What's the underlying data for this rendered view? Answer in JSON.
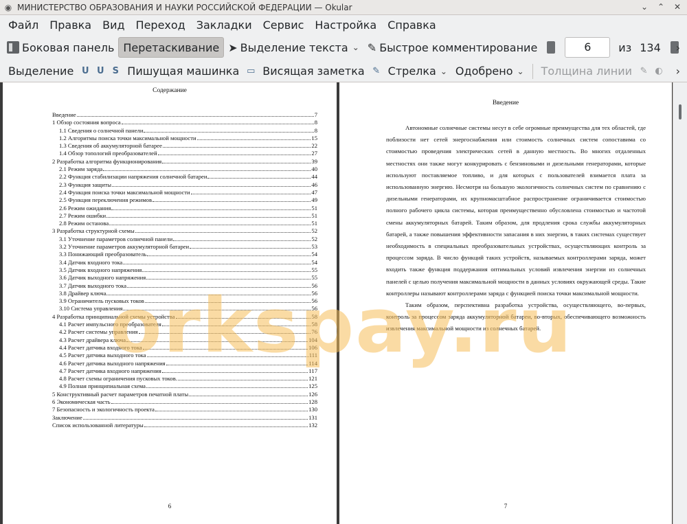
{
  "window": {
    "title": "МИНИСТЕРСТВО ОБРАЗОВАНИЯ И НАУКИ РОССИЙСКОЙ ФЕДЕРАЦИИ  — Okular"
  },
  "menu": [
    "Файл",
    "Правка",
    "Вид",
    "Переход",
    "Закладки",
    "Сервис",
    "Настройка",
    "Справка"
  ],
  "toolbar1": {
    "sidebar": "Боковая панель",
    "browse": "Перетаскивание",
    "text_select": "Выделение текста",
    "quick_comment": "Быстрое комментирование",
    "page_current": "6",
    "page_of": "из",
    "page_total": "134"
  },
  "toolbar2": {
    "highlight": "Выделение",
    "typewriter": "Пишущая машинка",
    "hanging_note": "Висящая заметка",
    "arrow": "Стрелка",
    "approved": "Одобрено",
    "line_width": "Толщина линии"
  },
  "left_page": {
    "title": "Содержание",
    "page_number": "6",
    "toc": [
      {
        "label": "Введение",
        "page": "7",
        "level": 1
      },
      {
        "label": "1 Обзор состояния вопроса",
        "page": "8",
        "level": 1
      },
      {
        "label": "1.1 Сведения о солнечной панели",
        "page": "8",
        "level": 2
      },
      {
        "label": "1.2 Алгоритмы поиска точки максимальной мощности",
        "page": "15",
        "level": 2
      },
      {
        "label": "1.3 Сведения об аккумуляторной батарее",
        "page": "22",
        "level": 2
      },
      {
        "label": "1.4 Обзор топологий преобразователей",
        "page": "27",
        "level": 2
      },
      {
        "label": "2 Разработка алгоритма функционирования",
        "page": "39",
        "level": 1
      },
      {
        "label": "2.1 Режим заряда",
        "page": "40",
        "level": 2
      },
      {
        "label": "2.2 Функция стабилизации напряжения солнечной батареи",
        "page": "44",
        "level": 2
      },
      {
        "label": "2.3 Функция защиты",
        "page": "46",
        "level": 2
      },
      {
        "label": "2.4 Функция поиска точки максимальной мощности",
        "page": "47",
        "level": 2
      },
      {
        "label": "2.5 Функция переключения режимов",
        "page": "49",
        "level": 2
      },
      {
        "label": "2.6 Режим ожидания",
        "page": "51",
        "level": 2
      },
      {
        "label": "2.7 Режим ошибки",
        "page": "51",
        "level": 2
      },
      {
        "label": "2.8 Режим останова",
        "page": "51",
        "level": 2
      },
      {
        "label": "3 Разработка структурной схемы",
        "page": "52",
        "level": 1
      },
      {
        "label": "3.1 Уточнение параметров солнечной панели",
        "page": "52",
        "level": 2
      },
      {
        "label": "3.2 Уточнение параметров аккумуляторной батареи",
        "page": "53",
        "level": 2
      },
      {
        "label": "3.3 Понижающий преобразователь",
        "page": "54",
        "level": 2
      },
      {
        "label": "3.4 Датчик входного тока",
        "page": "54",
        "level": 2
      },
      {
        "label": "3.5 Датчик входного напряжения",
        "page": "55",
        "level": 2
      },
      {
        "label": "3.6 Датчик выходного напряжения",
        "page": "55",
        "level": 2
      },
      {
        "label": "3.7 Датчик выходного тока",
        "page": "56",
        "level": 2
      },
      {
        "label": "3.8 Драйвер ключа",
        "page": "56",
        "level": 2
      },
      {
        "label": "3.9 Ограничитель пусковых токов",
        "page": "56",
        "level": 2
      },
      {
        "label": "3.10 Система управления",
        "page": "56",
        "level": 2
      },
      {
        "label": "4 Разработка принципиальной схемы устройства",
        "page": "58",
        "level": 1
      },
      {
        "label": "4.1 Расчет импульсного преобразователя",
        "page": "58",
        "level": 2
      },
      {
        "label": "4.2 Расчет системы управления",
        "page": "76",
        "level": 2
      },
      {
        "label": "4.3 Расчет драйвера ключа",
        "page": "104",
        "level": 2
      },
      {
        "label": "4.4  Расчет датчика входного тока",
        "page": "106",
        "level": 2
      },
      {
        "label": "4.5 Расчет датчика выходного тока",
        "page": "111",
        "level": 2
      },
      {
        "label": "4.6 Расчет датчика выходного напряжения",
        "page": "114",
        "level": 2
      },
      {
        "label": "4.7  Расчет датчика входного напряжения",
        "page": "117",
        "level": 2
      },
      {
        "label": "4.8 Расчет схемы ограничения пусковых токов. ",
        "page": "121",
        "level": 2
      },
      {
        "label": "4.9 Полная принципиальная схема",
        "page": "125",
        "level": 2
      },
      {
        "label": "5 Конструктивный расчет параметров печатной платы",
        "page": "126",
        "level": 1
      },
      {
        "label": "6 Экономическая часть",
        "page": "128",
        "level": 1
      },
      {
        "label": "7 Безопасность и экологичность проекта",
        "page": "130",
        "level": 1
      },
      {
        "label": "Заключение",
        "page": "131",
        "level": 1
      },
      {
        "label": "Список использованной литературы",
        "page": "132",
        "level": 1
      }
    ]
  },
  "right_page": {
    "title": "Введение",
    "page_number": "7",
    "paragraph1": "Автономные солнечные системы несут в себе огромные преимущества для тех областей, где поблизости нет сетей энергоснабжения или стоимость солнечных систем сопоставима со стоимостью проведения электрических сетей в данную местность. Во многих отдаленных местностях они также могут конкурировать с бензиновыми и дизельными генераторами, которые используют поставляемое топливо, и для которых с пользователей взимается плата за использованную энергию. Несмотря на большую экологичность солнечных систем по сравнению с дизельными генераторами, их крупномасштабное распространение ограничивается стоимостью полного рабочего цикла системы, которая преимущественно обусловлена стоимостью и частотой смены аккумуляторных батарей. Таким образом, для продления срока службы аккумуляторных батарей, а также повышения эффективности запасания в них энергии, в таких системах существует необходимость в специальных преобразовательных устройствах, осуществляющих контроль за процессом заряда. В число функций таких устройств, называемых контроллерами заряда, может входить также функция поддержания оптимальных условий извлечения энергии из солнечных панелей с целью получения максимальной мощности в данных условиях окружающей среды. Такие контроллеры называют контроллерами заряда с функцией поиска точки максимальной мощности.",
    "paragraph2": "Таким образом, перспективна разработка устройства, осуществляющего, во-первых, контроль за процессом заряда аккумуляторной батареи, во-вторых, обеспечивающего возможность извлечения максимальной мощности из солнечных батарей."
  },
  "watermark": "orkspay.ru"
}
